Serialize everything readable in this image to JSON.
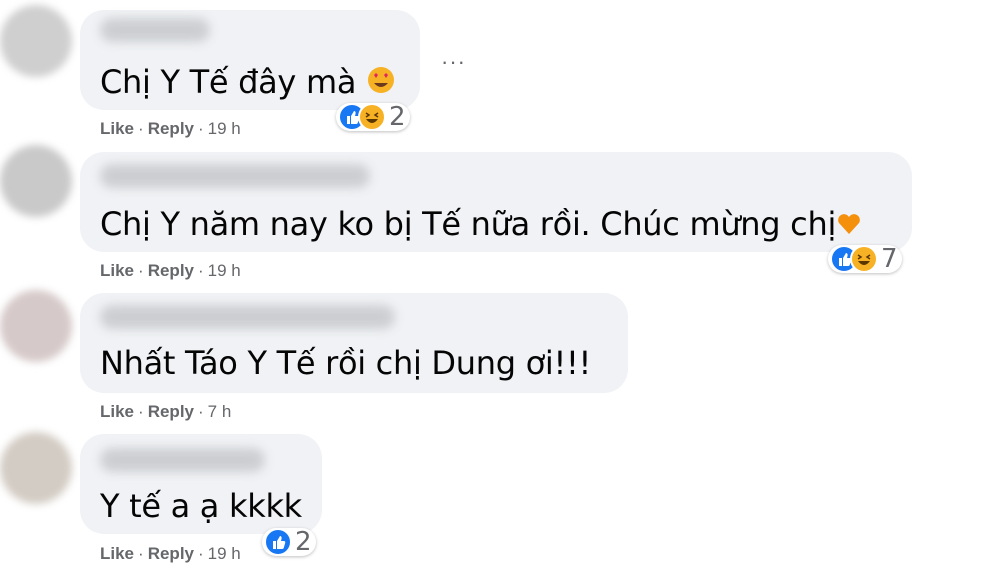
{
  "comments": [
    {
      "text": "Chị Y Tế đây mà",
      "emoji": "heart-eyes",
      "actions": {
        "like": "Like",
        "reply": "Reply",
        "time": "19 h"
      },
      "reaction_count": "2",
      "reactions": [
        "like",
        "haha"
      ]
    },
    {
      "text": "Chị Y năm nay ko bị Tế nữa rồi. Chúc mừng chị",
      "emoji": "orange-heart",
      "actions": {
        "like": "Like",
        "reply": "Reply",
        "time": "19 h"
      },
      "reaction_count": "7",
      "reactions": [
        "like",
        "haha"
      ]
    },
    {
      "text": "Nhất Táo Y Tế rồi chị Dung ơi!!!",
      "actions": {
        "like": "Like",
        "reply": "Reply",
        "time": "7 h"
      }
    },
    {
      "text": "Y tế a ạ kkkk",
      "actions": {
        "like": "Like",
        "reply": "Reply",
        "time": "19 h"
      },
      "reaction_count": "2",
      "reactions": [
        "like"
      ]
    }
  ],
  "menu": {
    "more_label": "···"
  },
  "colors": {
    "bubble": "#f0f2f5",
    "like_blue": "#1877f2",
    "haha_yellow": "#f7b125",
    "meta_gray": "#65676b"
  }
}
